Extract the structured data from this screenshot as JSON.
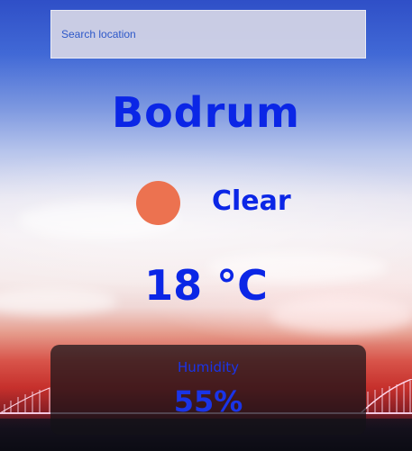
{
  "search": {
    "placeholder": "Search location",
    "value": ""
  },
  "weather": {
    "city": "Bodrum",
    "condition": "Clear",
    "condition_icon": "sun-icon",
    "temperature": "18 °C"
  },
  "humidity": {
    "label": "Humidity",
    "value": "55%"
  },
  "colors": {
    "text_primary": "#0b26e6",
    "sun": "#ec7250",
    "card_bg": "rgba(20,18,24,0.72)"
  }
}
